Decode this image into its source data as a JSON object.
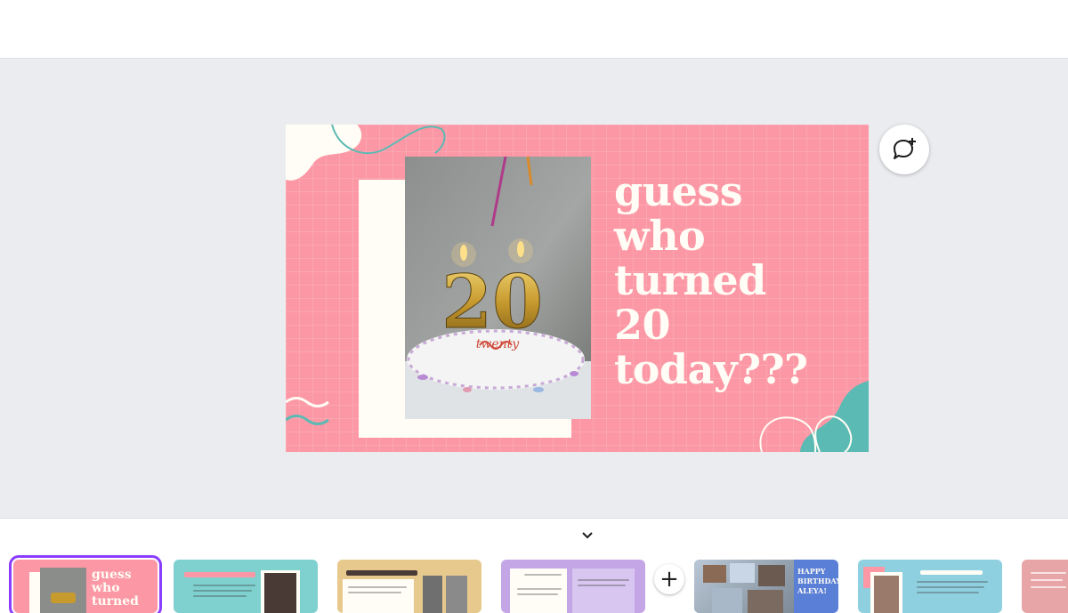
{
  "slide": {
    "headline_lines": [
      "guess",
      "who",
      "turned",
      "20",
      "today???"
    ],
    "photo_text": "twenty",
    "candle_number": "20",
    "colors": {
      "background": "#fc98a5",
      "teal": "#5bbab3",
      "cream": "#fffdf5"
    }
  },
  "comment_button": {
    "icon": "add-comment-icon"
  },
  "filmstrip": {
    "collapse_icon": "chevron-down-icon",
    "add_page_label": "+",
    "thumbnails": [
      {
        "title": "guess who turned",
        "selected": true
      },
      {
        "title": "",
        "selected": false
      },
      {
        "title": "",
        "selected": false
      },
      {
        "title": "",
        "selected": false
      },
      {
        "title": "HAPPY BIRTHDAY ALEYA!",
        "selected": false
      },
      {
        "title": "",
        "selected": false
      },
      {
        "title": "",
        "selected": false
      }
    ]
  }
}
